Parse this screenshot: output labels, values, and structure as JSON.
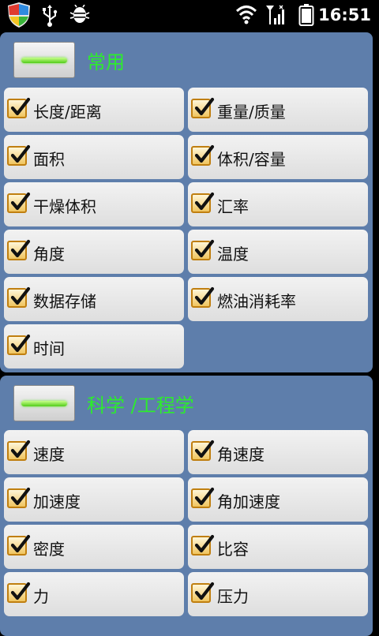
{
  "status_bar": {
    "time": "16:51",
    "icons": [
      "shield-app-icon",
      "usb-icon",
      "android-debug-icon",
      "wifi-icon",
      "signal-icon",
      "battery-icon"
    ]
  },
  "colors": {
    "section_bg": "#5e7eab",
    "section_title": "#2dec2d",
    "toggle_indicator": "#52cc1a",
    "checkbox_border": "#c07f10"
  },
  "sections": [
    {
      "title": "常用",
      "items": [
        {
          "label": "长度/距离",
          "checked": true
        },
        {
          "label": "重量/质量",
          "checked": true
        },
        {
          "label": "面积",
          "checked": true
        },
        {
          "label": "体积/容量",
          "checked": true
        },
        {
          "label": "干燥体积",
          "checked": true
        },
        {
          "label": "汇率",
          "checked": true
        },
        {
          "label": "角度",
          "checked": true
        },
        {
          "label": "温度",
          "checked": true
        },
        {
          "label": "数据存储",
          "checked": true
        },
        {
          "label": "燃油消耗率",
          "checked": true
        },
        {
          "label": "时间",
          "checked": true
        }
      ]
    },
    {
      "title": "科学 /工程学",
      "items": [
        {
          "label": "速度",
          "checked": true
        },
        {
          "label": "角速度",
          "checked": true
        },
        {
          "label": "加速度",
          "checked": true
        },
        {
          "label": "角加速度",
          "checked": true
        },
        {
          "label": "密度",
          "checked": true
        },
        {
          "label": "比容",
          "checked": true
        },
        {
          "label": "力",
          "checked": true
        },
        {
          "label": "压力",
          "checked": true
        }
      ]
    }
  ]
}
